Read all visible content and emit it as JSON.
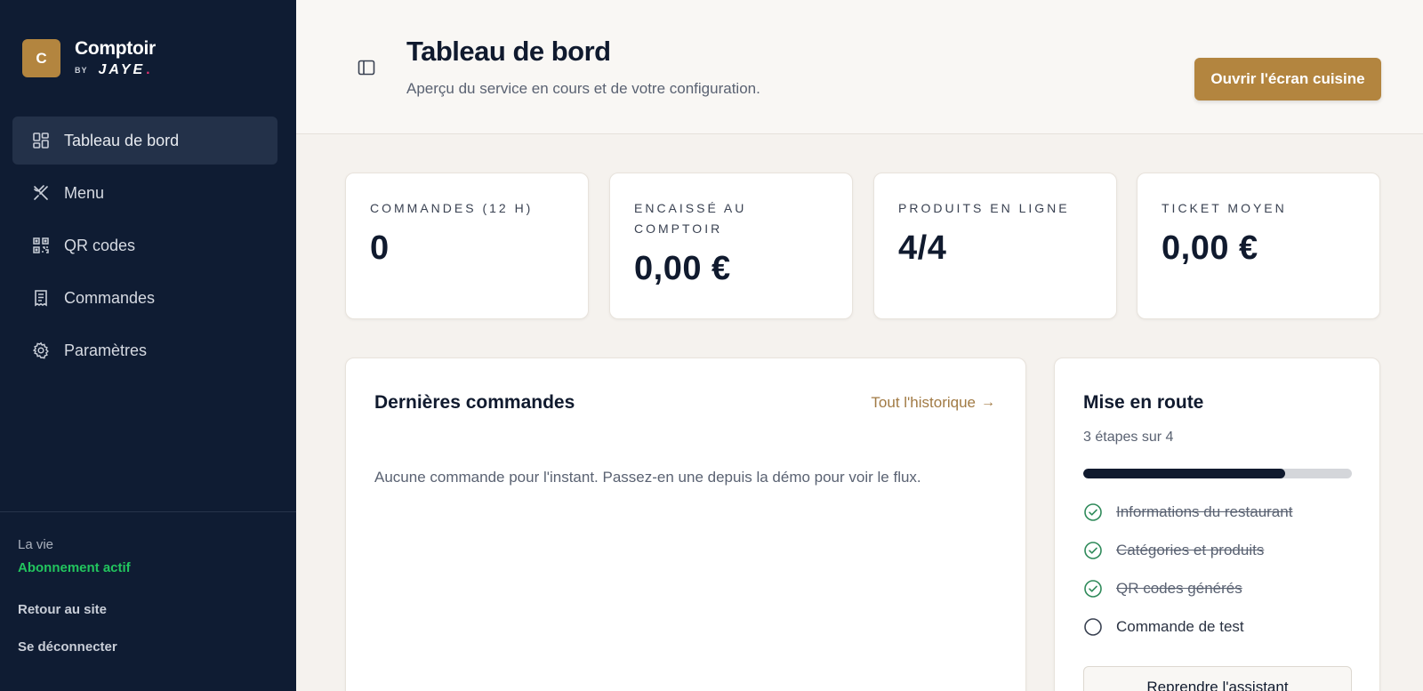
{
  "brand": {
    "logo_letter": "C",
    "name": "Comptoir",
    "by": "BY",
    "partner": "JAYE",
    "partner_dot": "."
  },
  "sidebar": {
    "items": [
      {
        "label": "Tableau de bord",
        "icon": "dashboard-icon",
        "active": true
      },
      {
        "label": "Menu",
        "icon": "utensils-icon",
        "active": false
      },
      {
        "label": "QR codes",
        "icon": "qr-code-icon",
        "active": false
      },
      {
        "label": "Commandes",
        "icon": "receipt-icon",
        "active": false
      },
      {
        "label": "Paramètres",
        "icon": "gear-icon",
        "active": false
      }
    ],
    "plan": "La vie",
    "subscription": "Abonnement actif",
    "back_link": "Retour au site",
    "logout": "Se déconnecter"
  },
  "header": {
    "title": "Tableau de bord",
    "subtitle": "Aperçu du service en cours et de votre configuration.",
    "kitchen_button": "Ouvrir l'écran cuisine"
  },
  "stats": [
    {
      "label": "Commandes (12 h)",
      "value": "0"
    },
    {
      "label": "Encaissé au comptoir",
      "value": "0,00 €"
    },
    {
      "label": "Produits en ligne",
      "value": "4/4"
    },
    {
      "label": "Ticket moyen",
      "value": "0,00 €"
    }
  ],
  "orders": {
    "title": "Dernières commandes",
    "history_link": "Tout l'historique",
    "history_arrow": "→",
    "empty": "Aucune commande pour l'instant. Passez-en une depuis la démo pour voir le flux."
  },
  "onboarding": {
    "title": "Mise en route",
    "steps_count": "3 étapes sur 4",
    "progress": 0.75,
    "steps": [
      {
        "label": "Informations du restaurant",
        "done": true
      },
      {
        "label": "Catégories et produits",
        "done": true
      },
      {
        "label": "QR codes générés",
        "done": true
      },
      {
        "label": "Commande de test",
        "done": false
      }
    ],
    "resume_button": "Reprendre l'assistant"
  },
  "colors": {
    "sidebar_bg": "#0f1c33",
    "accent": "#b3853f",
    "success": "#22c55e",
    "step_done": "#2f8a5a"
  }
}
